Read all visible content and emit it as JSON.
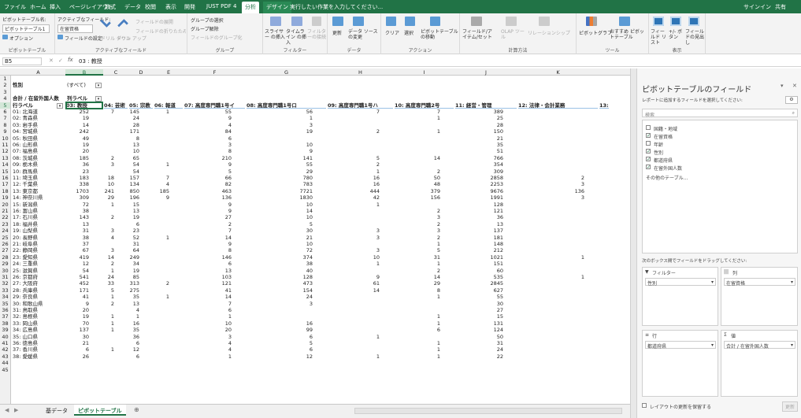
{
  "menubar": {
    "tabs": [
      "ファイル",
      "ホーム",
      "挿入",
      "ページレイアウト",
      "数式",
      "データ",
      "校閲",
      "表示",
      "開発",
      "JUST PDF 4",
      "分析",
      "デザイン"
    ],
    "tell_me": "実行したい作業を入力してください...",
    "signin": "サインイン",
    "share": "共有"
  },
  "ribbon": {
    "pt_name_label": "ピボットテーブル名:",
    "pt_name_value": "ピボットテーブル1",
    "active_field_label": "アクティブなフィールド:",
    "active_field_value": "在留資格",
    "options": "オプション",
    "field_settings": "フィールドの設定",
    "drill_down": "ドリル ダウン",
    "drill_up": "ドリル アップ",
    "expand_field": "フィールドの展開",
    "collapse_field": "フィールドの折りたたみ",
    "group_selection": "グループの選択",
    "ungroup": "グループ解除",
    "group_field": "フィールドのグループ化",
    "slicer": "スライサー の挿入",
    "timeline": "タイムライン の挿入",
    "filter_conn": "フィルターの接続",
    "refresh": "更新",
    "change_source": "データ ソース の変更",
    "clear": "クリア",
    "select": "選択",
    "move_pt": "ピボットテーブル の移動",
    "fields_items": "フィールド/アイテム/セット",
    "olap": "OLAP ツール",
    "relations": "リレーションシップ",
    "pivot_chart": "ピボットグラフ",
    "recommended": "おすすめ ピボットテーブル",
    "field_list": "フィールド リスト",
    "buttons": "+/- ボタン",
    "headers": "フィールドの見出し",
    "groups": [
      "ピボットテーブル",
      "アクティブなフィールド",
      "グループ",
      "フィルター",
      "データ",
      "アクション",
      "計算方法",
      "ツール",
      "表示"
    ]
  },
  "formula": {
    "namebox": "B5",
    "content": "03 : 教授"
  },
  "columns": [
    "A",
    "B",
    "C",
    "D",
    "E",
    "F",
    "G",
    "H",
    "I",
    "J",
    "K"
  ],
  "sheet": {
    "r2": {
      "label": "性別",
      "value": "(すべて)"
    },
    "r4": {
      "label": "合計 / 在留外国人数",
      "col_label": "列ラベル"
    },
    "r5": {
      "label": "行ラベル",
      "cols": [
        "03: 教授",
        "04: 芸術",
        "05: 宗教",
        "06: 報道",
        "07: 高度専門職1号イ",
        "08: 高度専門職1号ロ",
        "09: 高度専門職1号ハ",
        "10: 高度専門職2号",
        "11: 経営・管理",
        "12: 法律・会計業務",
        "13:"
      ]
    },
    "rows": [
      {
        "p": "01: 北海道",
        "b": "252",
        "c": "7",
        "d": "145",
        "e": "1",
        "f": "55",
        "g": "56",
        "h": "7",
        "i": "7",
        "j": "389",
        "k": ""
      },
      {
        "p": "02: 青森県",
        "b": "19",
        "c": "",
        "d": "24",
        "e": "",
        "f": "9",
        "g": "1",
        "h": "",
        "i": "1",
        "j": "25",
        "k": ""
      },
      {
        "p": "03: 岩手県",
        "b": "14",
        "c": "",
        "d": "28",
        "e": "",
        "f": "4",
        "g": "3",
        "h": "",
        "i": "",
        "j": "28",
        "k": ""
      },
      {
        "p": "04: 宮城県",
        "b": "242",
        "c": "",
        "d": "171",
        "e": "",
        "f": "84",
        "g": "19",
        "h": "2",
        "i": "1",
        "j": "150",
        "k": ""
      },
      {
        "p": "05: 秋田県",
        "b": "49",
        "c": "",
        "d": "8",
        "e": "",
        "f": "6",
        "g": "",
        "h": "",
        "i": "",
        "j": "21",
        "k": ""
      },
      {
        "p": "06: 山形県",
        "b": "19",
        "c": "",
        "d": "13",
        "e": "",
        "f": "3",
        "g": "10",
        "h": "",
        "i": "",
        "j": "35",
        "k": ""
      },
      {
        "p": "07: 福島県",
        "b": "20",
        "c": "",
        "d": "10",
        "e": "",
        "f": "8",
        "g": "9",
        "h": "",
        "i": "",
        "j": "51",
        "k": ""
      },
      {
        "p": "08: 茨城県",
        "b": "185",
        "c": "2",
        "d": "65",
        "e": "",
        "f": "210",
        "g": "141",
        "h": "5",
        "i": "14",
        "j": "766",
        "k": ""
      },
      {
        "p": "09: 栃木県",
        "b": "36",
        "c": "3",
        "d": "54",
        "e": "1",
        "f": "9",
        "g": "55",
        "h": "2",
        "i": "",
        "j": "354",
        "k": ""
      },
      {
        "p": "10: 群馬県",
        "b": "23",
        "c": "",
        "d": "54",
        "e": "",
        "f": "5",
        "g": "29",
        "h": "1",
        "i": "2",
        "j": "309",
        "k": ""
      },
      {
        "p": "11: 埼玉県",
        "b": "183",
        "c": "18",
        "d": "157",
        "e": "7",
        "f": "66",
        "g": "780",
        "h": "16",
        "i": "50",
        "j": "2858",
        "k": "2"
      },
      {
        "p": "12: 千葉県",
        "b": "338",
        "c": "10",
        "d": "134",
        "e": "4",
        "f": "82",
        "g": "783",
        "h": "16",
        "i": "48",
        "j": "2253",
        "k": "3"
      },
      {
        "p": "13: 東京都",
        "b": "1703",
        "c": "241",
        "d": "850",
        "e": "185",
        "f": "463",
        "g": "7721",
        "h": "444",
        "i": "379",
        "j": "9676",
        "k": "136"
      },
      {
        "p": "14: 神奈川県",
        "b": "309",
        "c": "29",
        "d": "196",
        "e": "9",
        "f": "136",
        "g": "1830",
        "h": "42",
        "i": "156",
        "j": "1991",
        "k": "3"
      },
      {
        "p": "15: 新潟県",
        "b": "72",
        "c": "1",
        "d": "15",
        "e": "",
        "f": "9",
        "g": "10",
        "h": "1",
        "i": "",
        "j": "128",
        "k": ""
      },
      {
        "p": "16: 富山県",
        "b": "38",
        "c": "",
        "d": "13",
        "e": "",
        "f": "9",
        "g": "14",
        "h": "",
        "i": "2",
        "j": "121",
        "k": ""
      },
      {
        "p": "17: 石川県",
        "b": "143",
        "c": "2",
        "d": "19",
        "e": "",
        "f": "27",
        "g": "10",
        "h": "",
        "i": "3",
        "j": "36",
        "k": ""
      },
      {
        "p": "18: 福井県",
        "b": "13",
        "c": "",
        "d": "6",
        "e": "",
        "f": "2",
        "g": "5",
        "h": "",
        "i": "2",
        "j": "13",
        "k": ""
      },
      {
        "p": "19: 山梨県",
        "b": "31",
        "c": "3",
        "d": "23",
        "e": "",
        "f": "7",
        "g": "30",
        "h": "3",
        "i": "3",
        "j": "137",
        "k": ""
      },
      {
        "p": "20: 長野県",
        "b": "38",
        "c": "4",
        "d": "52",
        "e": "1",
        "f": "14",
        "g": "21",
        "h": "3",
        "i": "2",
        "j": "181",
        "k": ""
      },
      {
        "p": "21: 岐阜県",
        "b": "37",
        "c": "",
        "d": "31",
        "e": "",
        "f": "9",
        "g": "10",
        "h": "",
        "i": "1",
        "j": "148",
        "k": ""
      },
      {
        "p": "22: 静岡県",
        "b": "67",
        "c": "3",
        "d": "64",
        "e": "",
        "f": "8",
        "g": "72",
        "h": "3",
        "i": "5",
        "j": "212",
        "k": ""
      },
      {
        "p": "23: 愛知県",
        "b": "419",
        "c": "14",
        "d": "249",
        "e": "",
        "f": "146",
        "g": "374",
        "h": "10",
        "i": "31",
        "j": "1021",
        "k": "1"
      },
      {
        "p": "24: 三重県",
        "b": "12",
        "c": "2",
        "d": "34",
        "e": "",
        "f": "6",
        "g": "38",
        "h": "1",
        "i": "1",
        "j": "151",
        "k": ""
      },
      {
        "p": "25: 滋賀県",
        "b": "54",
        "c": "1",
        "d": "19",
        "e": "",
        "f": "13",
        "g": "40",
        "h": "",
        "i": "2",
        "j": "60",
        "k": ""
      },
      {
        "p": "26: 京都府",
        "b": "541",
        "c": "24",
        "d": "85",
        "e": "",
        "f": "103",
        "g": "128",
        "h": "9",
        "i": "14",
        "j": "535",
        "k": "1"
      },
      {
        "p": "27: 大阪府",
        "b": "452",
        "c": "33",
        "d": "313",
        "e": "2",
        "f": "121",
        "g": "473",
        "h": "61",
        "i": "29",
        "j": "2845",
        "k": ""
      },
      {
        "p": "28: 兵庫県",
        "b": "171",
        "c": "5",
        "d": "275",
        "e": "",
        "f": "41",
        "g": "154",
        "h": "14",
        "i": "8",
        "j": "627",
        "k": ""
      },
      {
        "p": "29: 奈良県",
        "b": "41",
        "c": "1",
        "d": "35",
        "e": "1",
        "f": "14",
        "g": "24",
        "h": "",
        "i": "1",
        "j": "55",
        "k": ""
      },
      {
        "p": "30: 和歌山県",
        "b": "9",
        "c": "2",
        "d": "13",
        "e": "",
        "f": "7",
        "g": "3",
        "h": "",
        "i": "",
        "j": "30",
        "k": ""
      },
      {
        "p": "31: 鳥取県",
        "b": "20",
        "c": "",
        "d": "4",
        "e": "",
        "f": "6",
        "g": "",
        "h": "",
        "i": "",
        "j": "27",
        "k": ""
      },
      {
        "p": "32: 島根県",
        "b": "19",
        "c": "1",
        "d": "1",
        "e": "",
        "f": "1",
        "g": "",
        "h": "",
        "i": "1",
        "j": "15",
        "k": ""
      },
      {
        "p": "33: 岡山県",
        "b": "70",
        "c": "1",
        "d": "16",
        "e": "",
        "f": "10",
        "g": "16",
        "h": "",
        "i": "1",
        "j": "131",
        "k": ""
      },
      {
        "p": "34: 広島県",
        "b": "137",
        "c": "1",
        "d": "35",
        "e": "",
        "f": "20",
        "g": "99",
        "h": "",
        "i": "6",
        "j": "124",
        "k": ""
      },
      {
        "p": "35: 山口県",
        "b": "30",
        "c": "",
        "d": "36",
        "e": "",
        "f": "3",
        "g": "6",
        "h": "1",
        "i": "",
        "j": "50",
        "k": ""
      },
      {
        "p": "36: 徳島県",
        "b": "21",
        "c": "",
        "d": "6",
        "e": "",
        "f": "4",
        "g": "5",
        "h": "",
        "i": "1",
        "j": "31",
        "k": ""
      },
      {
        "p": "37: 香川県",
        "b": "6",
        "c": "1",
        "d": "12",
        "e": "",
        "f": "4",
        "g": "6",
        "h": "",
        "i": "1",
        "j": "24",
        "k": ""
      },
      {
        "p": "38: 愛媛県",
        "b": "26",
        "c": "",
        "d": "6",
        "e": "",
        "f": "1",
        "g": "12",
        "h": "1",
        "i": "1",
        "j": "22",
        "k": ""
      }
    ]
  },
  "tabs": {
    "sheet1": "基データ",
    "sheet2": "ピボットテーブル",
    "add": "⊕"
  },
  "pane": {
    "title": "ピボットテーブルのフィールド",
    "subtitle": "レポートに追加するフィールドを選択してください:",
    "search": "検索",
    "fields": [
      {
        "name": "国籍・地域",
        "checked": false
      },
      {
        "name": "在留資格",
        "checked": true
      },
      {
        "name": "年齢",
        "checked": false
      },
      {
        "name": "性別",
        "checked": true
      },
      {
        "name": "都道府県",
        "checked": true
      },
      {
        "name": "在留外国人数",
        "checked": true
      }
    ],
    "other": "その他のテーブル...",
    "drag_label": "次のボックス間でフィールドをドラッグしてください:",
    "filter_lbl": "フィルター",
    "cols_lbl": "列",
    "rows_lbl": "行",
    "values_lbl": "値",
    "filter_item": "性別",
    "col_item": "在留資格",
    "row_item": "都道府県",
    "value_item": "合計 / 在留外国人数",
    "defer": "レイアウトの更新を保留する",
    "update": "更新"
  }
}
